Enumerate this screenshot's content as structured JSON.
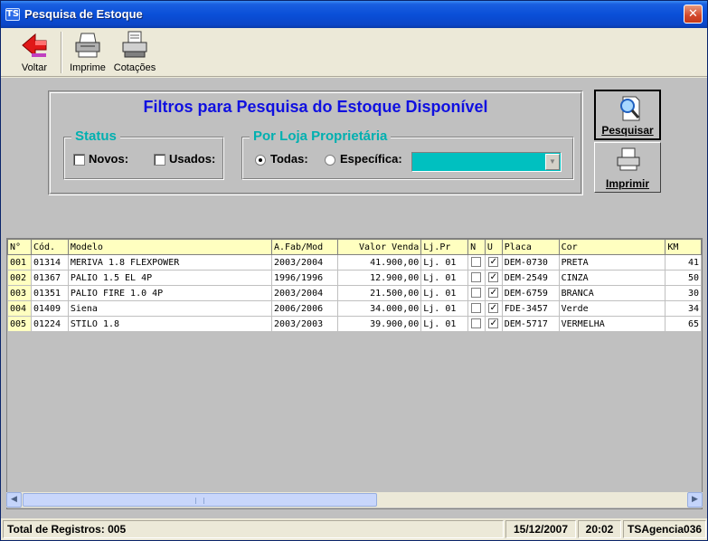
{
  "window": {
    "title": "Pesquisa de Estoque",
    "icon_text": "TS"
  },
  "toolbar": {
    "voltar": "Voltar",
    "imprime": "Imprime",
    "cotacoes": "Cotações"
  },
  "filters": {
    "title": "Filtros para Pesquisa do Estoque Disponível",
    "status": {
      "title": "Status",
      "novos": "Novos:",
      "usados": "Usados:",
      "novos_checked": false,
      "usados_checked": false
    },
    "loja": {
      "title": "Por Loja Proprietária",
      "todas": "Todas:",
      "especifica": "Específica:",
      "selected": "todas",
      "combo_value": ""
    }
  },
  "buttons": {
    "pesquisar": "Pesquisar",
    "imprimir": "Imprimir"
  },
  "grid": {
    "columns": [
      "N°",
      "Cód.",
      "Modelo",
      "A.Fab/Mod",
      "Valor Venda",
      "Lj.Pr",
      "N",
      "U",
      "Placa",
      "Cor",
      "KM"
    ],
    "rows": [
      {
        "n": "001",
        "cod": "01314",
        "modelo": "MERIVA 1.8 FLEXPOWER",
        "ano": "2003/2004",
        "valor": "41.900,00",
        "loja": "Lj. 01",
        "novo": false,
        "usado": true,
        "placa": "DEM-0730",
        "cor": "PRETA",
        "km": "41"
      },
      {
        "n": "002",
        "cod": "01367",
        "modelo": "PALIO 1.5 EL 4P",
        "ano": "1996/1996",
        "valor": "12.900,00",
        "loja": "Lj. 01",
        "novo": false,
        "usado": true,
        "placa": "DEM-2549",
        "cor": "CINZA",
        "km": "50"
      },
      {
        "n": "003",
        "cod": "01351",
        "modelo": "PALIO FIRE 1.0 4P",
        "ano": "2003/2004",
        "valor": "21.500,00",
        "loja": "Lj. 01",
        "novo": false,
        "usado": true,
        "placa": "DEM-6759",
        "cor": "BRANCA",
        "km": "30"
      },
      {
        "n": "004",
        "cod": "01409",
        "modelo": "Siena",
        "ano": "2006/2006",
        "valor": "34.000,00",
        "loja": "Lj. 01",
        "novo": false,
        "usado": true,
        "placa": "FDE-3457",
        "cor": "Verde",
        "km": "34"
      },
      {
        "n": "005",
        "cod": "01224",
        "modelo": "STILO 1.8",
        "ano": "2003/2003",
        "valor": "39.900,00",
        "loja": "Lj. 01",
        "novo": false,
        "usado": true,
        "placa": "DEM-5717",
        "cor": "VERMELHA",
        "km": "65"
      }
    ]
  },
  "status": {
    "total": "Total de Registros: 005",
    "date": "15/12/2007",
    "time": "20:02",
    "user": "TSAgencia036"
  },
  "colors": {
    "title_blue": "#1010e0",
    "group_cyan": "#00b0b0",
    "combo_cyan": "#00c0c0",
    "header_yellow": "#ffffc0"
  }
}
